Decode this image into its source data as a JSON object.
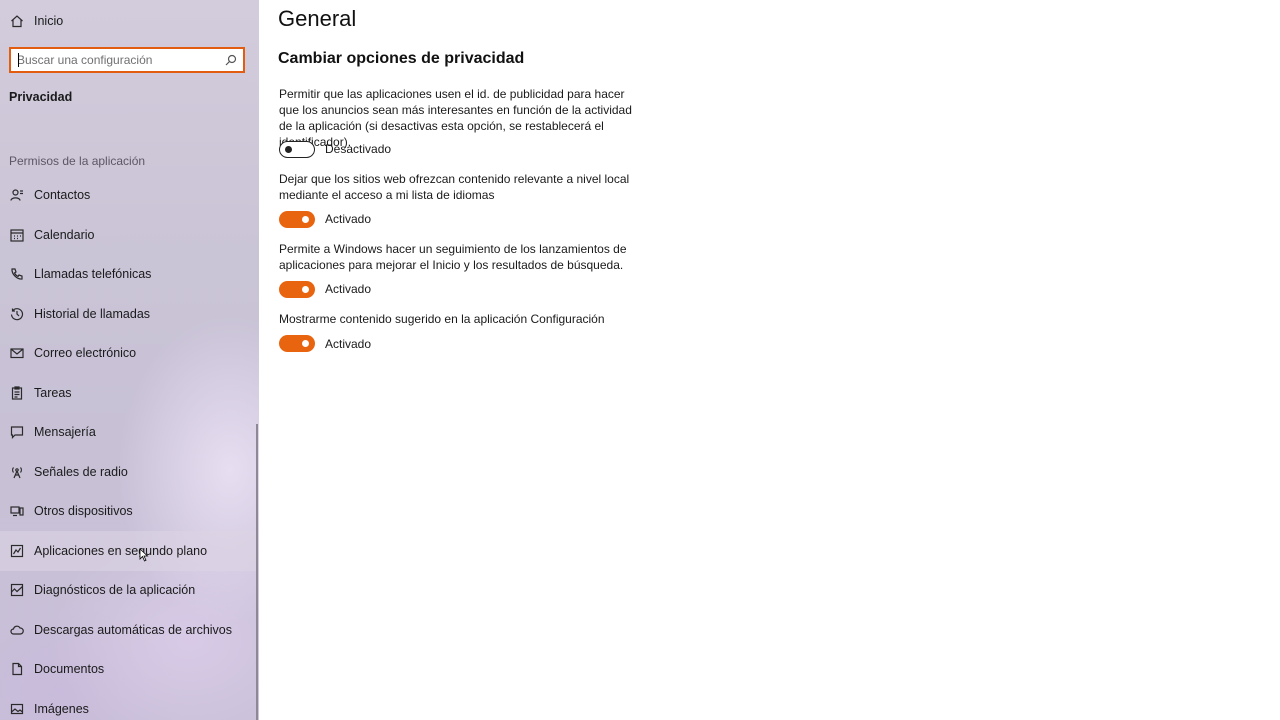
{
  "sidebar": {
    "home_label": "Inicio",
    "search_placeholder": "Buscar una configuración",
    "active_section": "Privacidad",
    "permissions_header": "Permisos de la aplicación",
    "items": [
      {
        "label": "Contactos",
        "icon": "contacts-icon"
      },
      {
        "label": "Calendario",
        "icon": "calendar-icon"
      },
      {
        "label": "Llamadas telefónicas",
        "icon": "phone-icon"
      },
      {
        "label": "Historial de llamadas",
        "icon": "history-icon"
      },
      {
        "label": "Correo electrónico",
        "icon": "mail-icon"
      },
      {
        "label": "Tareas",
        "icon": "tasks-icon"
      },
      {
        "label": "Mensajería",
        "icon": "message-icon"
      },
      {
        "label": "Señales de radio",
        "icon": "radio-icon"
      },
      {
        "label": "Otros dispositivos",
        "icon": "devices-icon"
      },
      {
        "label": "Aplicaciones en segundo plano",
        "icon": "background-apps-icon"
      },
      {
        "label": "Diagnósticos de la aplicación",
        "icon": "diagnostics-icon"
      },
      {
        "label": "Descargas automáticas de archivos",
        "icon": "cloud-icon"
      },
      {
        "label": "Documentos",
        "icon": "document-icon"
      },
      {
        "label": "Imágenes",
        "icon": "image-icon"
      }
    ]
  },
  "main": {
    "title": "General",
    "subtitle": "Cambiar opciones de privacidad",
    "settings": [
      {
        "description": "Permitir que las aplicaciones usen el id. de publicidad para hacer que los anuncios sean más interesantes en función de la actividad de la aplicación (si desactivas esta opción, se restablecerá el identificador).",
        "state": "Desactivado",
        "on": false
      },
      {
        "description": "Dejar que los sitios web ofrezcan contenido relevante a nivel local mediante el acceso a mi lista de idiomas",
        "state": "Activado",
        "on": true
      },
      {
        "description": "Permite a Windows hacer un seguimiento de los lanzamientos de aplicaciones para mejorar el Inicio y los resultados de búsqueda.",
        "state": "Activado",
        "on": true
      },
      {
        "description": "Mostrarme contenido sugerido en la aplicación Configuración",
        "state": "Activado",
        "on": true
      }
    ]
  },
  "colors": {
    "accent": "#e8640f",
    "search_border": "#e25c12"
  }
}
